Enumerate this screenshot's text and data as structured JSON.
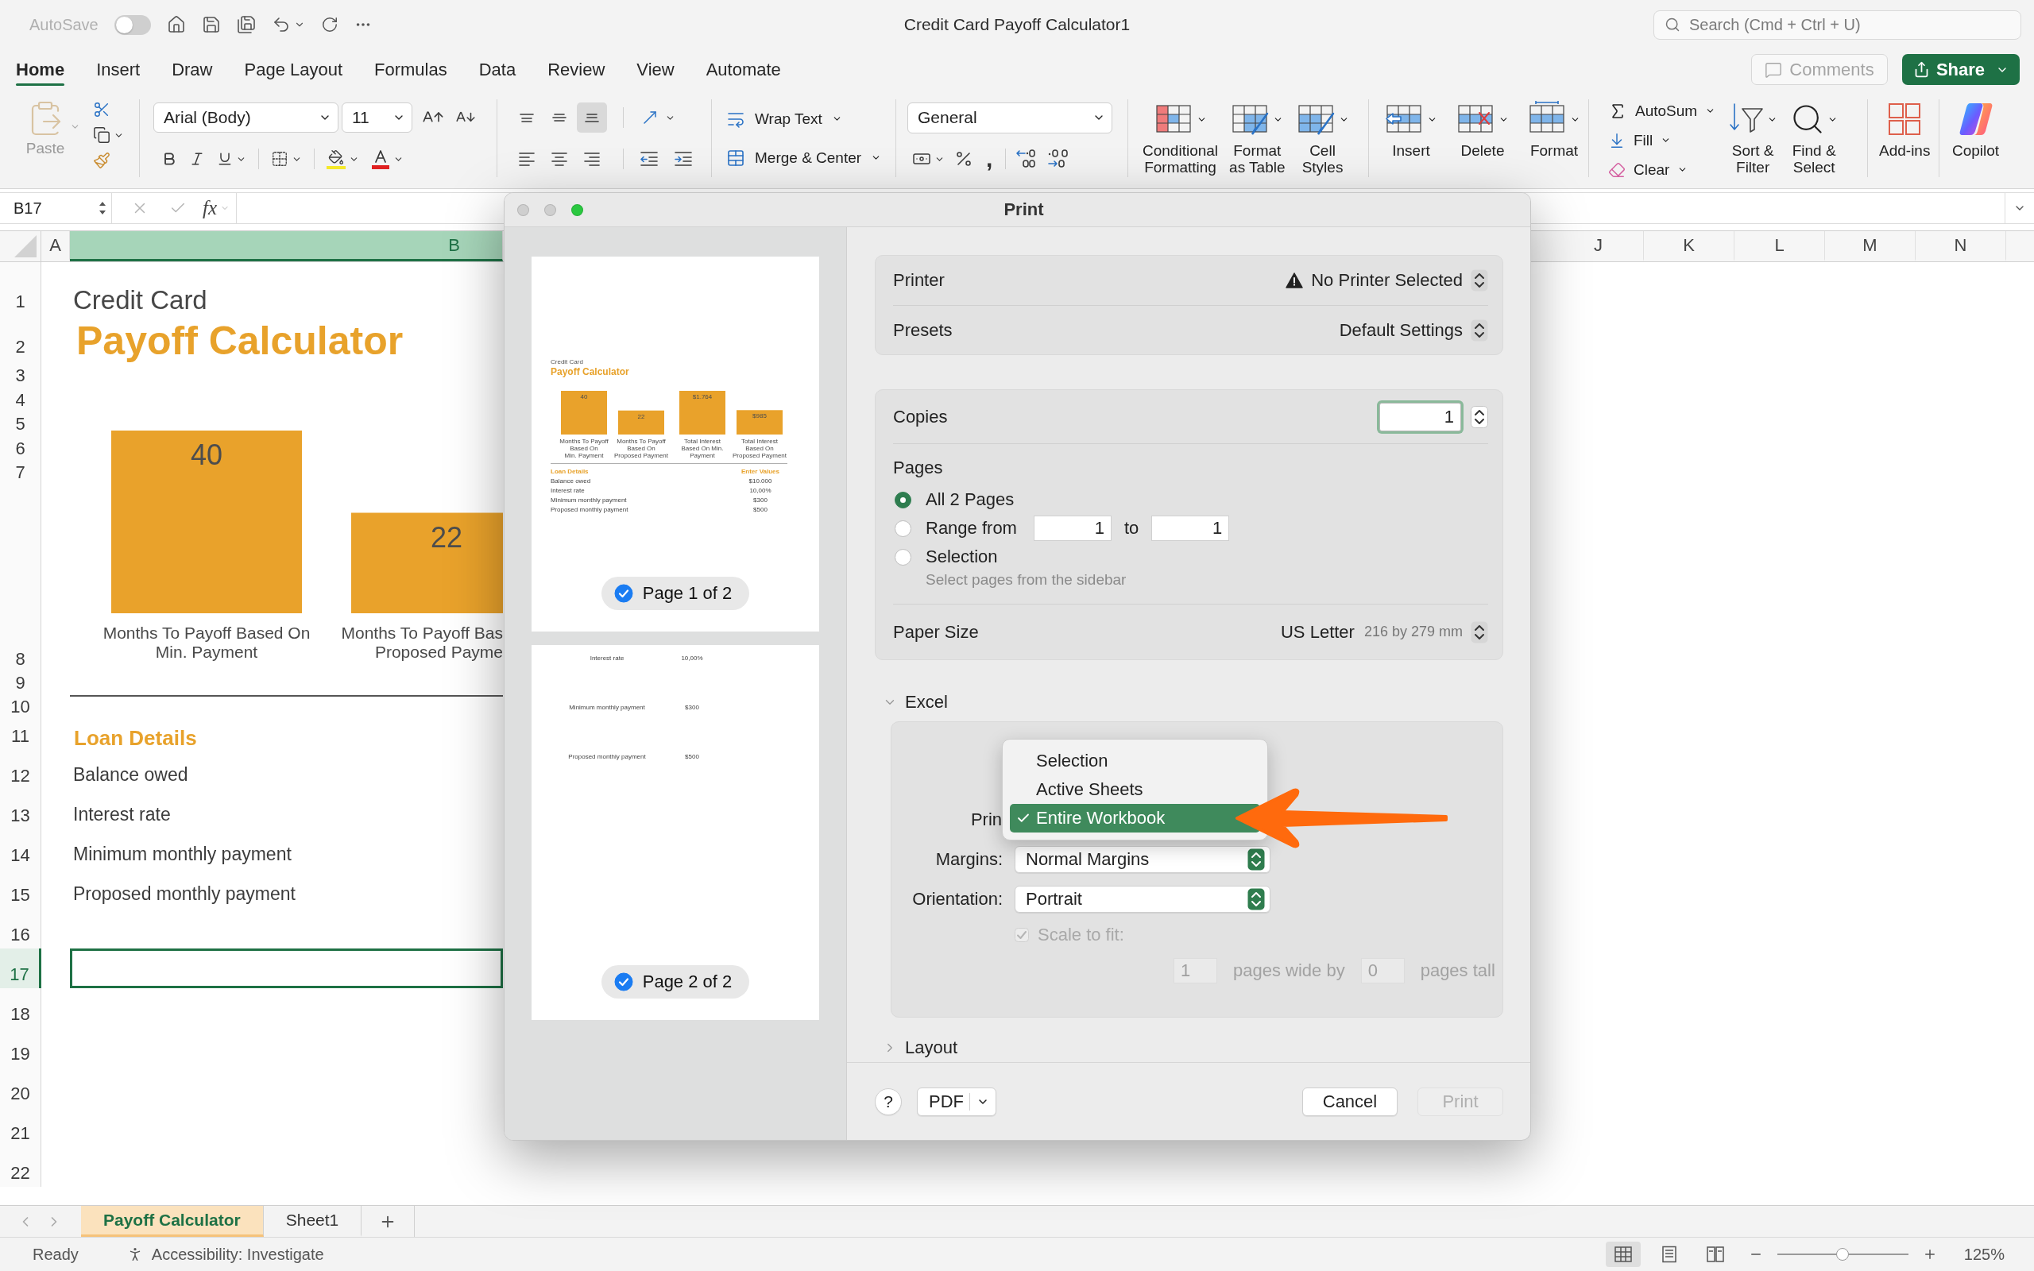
{
  "title_bar": {
    "autosave": {
      "label": "AutoSave",
      "on": false
    },
    "title": "Credit Card Payoff Calculator1",
    "search": {
      "placeholder": "Search (Cmd + Ctrl + U)"
    }
  },
  "ribbon_tabs": [
    {
      "label": "Home",
      "selected": true
    },
    {
      "label": "Insert",
      "selected": false
    },
    {
      "label": "Draw",
      "selected": false
    },
    {
      "label": "Page Layout",
      "selected": false
    },
    {
      "label": "Formulas",
      "selected": false
    },
    {
      "label": "Data",
      "selected": false
    },
    {
      "label": "Review",
      "selected": false
    },
    {
      "label": "View",
      "selected": false
    },
    {
      "label": "Automate",
      "selected": false
    }
  ],
  "comments_button": {
    "label": "Comments",
    "disabled": true
  },
  "share_button": {
    "label": "Share"
  },
  "ribbon": {
    "paste": {
      "label": "Paste",
      "disabled": true
    },
    "font_name": "Arial (Body)",
    "font_size": "11",
    "vertical_align": [
      {
        "kind": "top",
        "selected": false
      },
      {
        "kind": "middle",
        "selected": false
      },
      {
        "kind": "bottom",
        "selected": true
      }
    ],
    "wrap_text": "Wrap Text",
    "merge_center": "Merge & Center",
    "number_format": "General",
    "comma_style": ",",
    "styles": [
      {
        "kind": "conditional",
        "label": "Conditional\nFormatting"
      },
      {
        "kind": "table",
        "label": "Format\nas Table"
      },
      {
        "kind": "cell",
        "label": "Cell\nStyles"
      }
    ],
    "cells": [
      {
        "kind": "insert",
        "label": "Insert"
      },
      {
        "kind": "delete",
        "label": "Delete"
      },
      {
        "kind": "format",
        "label": "Format"
      }
    ],
    "editing": [
      {
        "kind": "autosum",
        "label": "AutoSum"
      },
      {
        "kind": "fill",
        "label": "Fill"
      },
      {
        "kind": "clear",
        "label": "Clear"
      }
    ],
    "sort_find": [
      {
        "kind": "sort",
        "label": "Sort &\nFilter"
      },
      {
        "kind": "find",
        "label": "Find &\nSelect"
      }
    ],
    "add_ins": "Add-ins",
    "copilot": "Copilot"
  },
  "formula_bar": {
    "name_box": "B17",
    "function_label": "fx"
  },
  "sheet": {
    "columns": [
      {
        "label": "A",
        "selected": false
      },
      {
        "label": "B",
        "selected": true
      },
      {
        "label": "J",
        "selected": false
      },
      {
        "label": "K",
        "selected": false
      },
      {
        "label": "L",
        "selected": false
      },
      {
        "label": "M",
        "selected": false
      },
      {
        "label": "N",
        "selected": false
      }
    ],
    "rows": [
      {
        "label": "1",
        "selected": false
      },
      {
        "label": "2",
        "selected": false
      },
      {
        "label": "3",
        "selected": false
      },
      {
        "label": "4",
        "selected": false
      },
      {
        "label": "5",
        "selected": false
      },
      {
        "label": "6",
        "selected": false
      },
      {
        "label": "7",
        "selected": false
      },
      {
        "label": "8",
        "selected": false
      },
      {
        "label": "9",
        "selected": false
      },
      {
        "label": "10",
        "selected": false
      },
      {
        "label": "11",
        "selected": false
      },
      {
        "label": "12",
        "selected": false
      },
      {
        "label": "13",
        "selected": false
      },
      {
        "label": "14",
        "selected": false
      },
      {
        "label": "15",
        "selected": false
      },
      {
        "label": "16",
        "selected": false
      },
      {
        "label": "17",
        "selected": true
      },
      {
        "label": "18",
        "selected": false
      },
      {
        "label": "19",
        "selected": false
      },
      {
        "label": "20",
        "selected": false
      },
      {
        "label": "21",
        "selected": false
      },
      {
        "label": "22",
        "selected": false
      }
    ],
    "title": "Credit Card",
    "heading": "Payoff Calculator",
    "chart_data": {
      "type": "bar",
      "categories": [
        "Months To Payoff Based On\nMin. Payment",
        "Months To Payoff Bas\nProposed Payme"
      ],
      "values": [
        40,
        22
      ],
      "data_labels": true
    },
    "section_heading": "Loan Details",
    "items": [
      "Balance owed",
      "Interest rate",
      "Minimum monthly payment",
      "Proposed monthly payment"
    ]
  },
  "sheet_tabs": [
    {
      "label": "Payoff Calculator",
      "selected": true
    },
    {
      "label": "Sheet1",
      "selected": false
    }
  ],
  "status_bar": {
    "status": "Ready",
    "accessibility": "Accessibility: Investigate",
    "views": [
      {
        "kind": "normal",
        "selected": true
      },
      {
        "kind": "page_layout",
        "selected": false
      },
      {
        "kind": "page_break",
        "selected": false
      }
    ],
    "zoom": {
      "level": 0.5,
      "reading": "125%"
    }
  },
  "print_dialog": {
    "title": "Print",
    "pages_preview": [
      {
        "label": "Page 1 of 2",
        "checked": true,
        "content": {
          "title": "Credit Card",
          "heading": "Payoff Calculator",
          "charts": [
            {
              "chart_data": {
                "type": "bar",
                "categories": [
                  "Months To Payoff Based On\nMin. Payment",
                  "Months To Payoff Based On\nProposed Payment"
                ],
                "values": [
                  40,
                  22
                ],
                "data_labels": true
              }
            },
            {
              "chart_data": {
                "type": "bar",
                "categories": [
                  "Total Interest Based On Min.\nPayment",
                  "Total Interest Based On\nProposed Payment"
                ],
                "values": [
                  1764,
                  985
                ],
                "value_labels": [
                  "$1.764",
                  "$985"
                ]
              }
            }
          ],
          "section_heading": "Loan Details",
          "values_heading": "Enter Values",
          "rows": [
            {
              "label": "Balance owed",
              "value": "$10.000"
            },
            {
              "label": "Interest rate",
              "value": "10,00%"
            },
            {
              "label": "Minimum monthly payment",
              "value": "$300"
            },
            {
              "label": "Proposed monthly payment",
              "value": "$500"
            }
          ]
        }
      },
      {
        "label": "Page 2 of 2",
        "checked": true,
        "content": {
          "rows": [
            {
              "label": "Interest rate",
              "value": "10,00%"
            },
            {
              "label": "Minimum monthly payment",
              "value": "$300"
            },
            {
              "label": "Proposed monthly payment",
              "value": "$500"
            }
          ]
        }
      }
    ],
    "printer": {
      "label": "Printer",
      "value": "No Printer Selected"
    },
    "presets": {
      "label": "Presets",
      "value": "Default Settings"
    },
    "copies": {
      "label": "Copies",
      "value": "1"
    },
    "pages": {
      "label": "Pages",
      "options": [
        {
          "kind": "all",
          "label": "All 2 Pages",
          "selected": true
        },
        {
          "kind": "range",
          "label": "Range from",
          "from": "1",
          "to_label": "to",
          "to": "1",
          "selected": false
        },
        {
          "kind": "selection",
          "label": "Selection",
          "hint": "Select pages from the sidebar",
          "selected": false
        }
      ]
    },
    "paper_size": {
      "label": "Paper Size",
      "value": "US Letter",
      "detail": "216 by 279 mm"
    },
    "excel": {
      "label": "Excel",
      "expanded": true,
      "print_label": "Prin",
      "print_menu": [
        {
          "label": "Selection",
          "selected": false
        },
        {
          "label": "Active Sheets",
          "selected": false
        },
        {
          "label": "Entire Workbook",
          "selected": true
        }
      ],
      "margins": {
        "label": "Margins:",
        "value": "Normal Margins"
      },
      "orientation": {
        "label": "Orientation:",
        "value": "Portrait"
      },
      "scale_to_fit": {
        "label": "Scale to fit:",
        "checked": true,
        "disabled": true
      },
      "pages_wide": "1",
      "pages_wide_label": "pages wide by",
      "pages_tall": "0",
      "pages_tall_label": "pages tall"
    },
    "layout": {
      "label": "Layout",
      "expanded": false
    },
    "help_button": "?",
    "pdf_button": "PDF",
    "cancel_button": "Cancel",
    "print_button": {
      "label": "Print",
      "disabled": true
    }
  }
}
